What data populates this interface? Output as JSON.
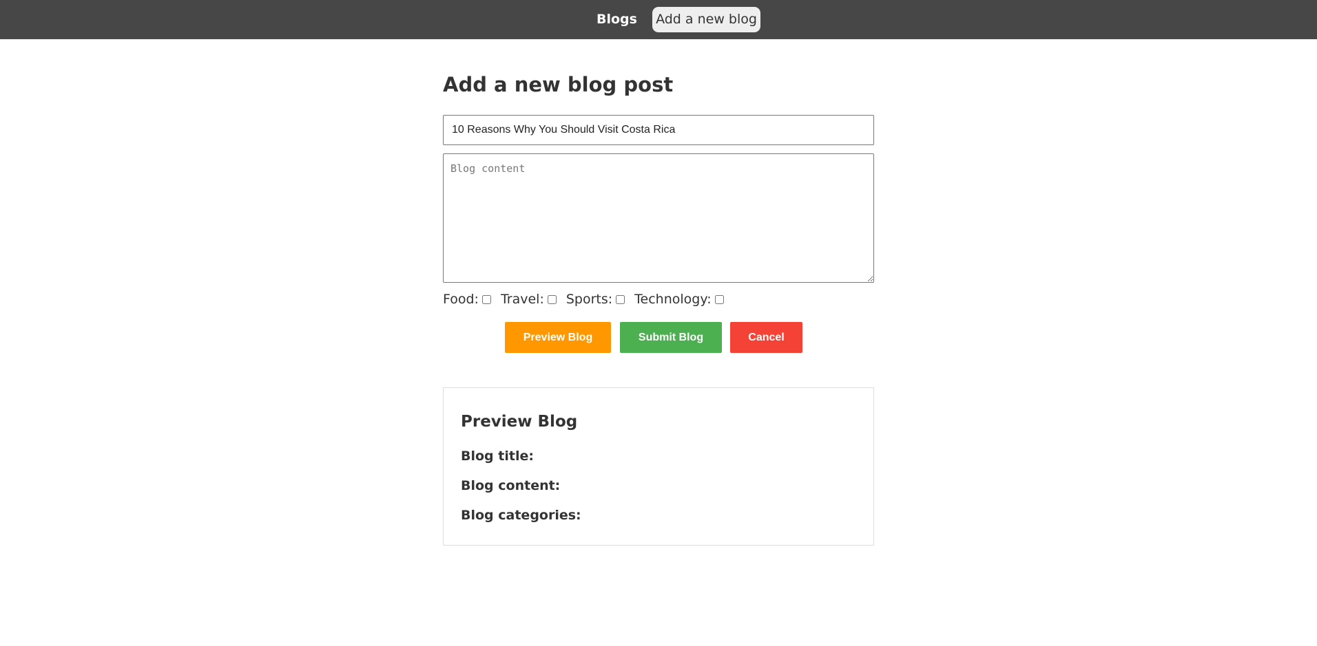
{
  "nav": {
    "blogs_label": "Blogs",
    "add_blog_label": "Add a new blog"
  },
  "form": {
    "heading": "Add a new blog post",
    "title_value": "10 Reasons Why You Should Visit Costa Rica",
    "content_value": "",
    "content_placeholder": "Blog content",
    "categories": [
      {
        "label": "Food:",
        "checked": false
      },
      {
        "label": "Travel:",
        "checked": false
      },
      {
        "label": "Sports:",
        "checked": false
      },
      {
        "label": "Technology:",
        "checked": false
      }
    ],
    "buttons": {
      "preview_label": "Preview Blog",
      "submit_label": "Submit Blog",
      "cancel_label": "Cancel"
    }
  },
  "preview": {
    "heading": "Preview Blog",
    "title_label": "Blog title:",
    "content_label": "Blog content:",
    "categories_label": "Blog categories:"
  },
  "colors": {
    "topbar": "#474747",
    "preview_button": "#ff9800",
    "submit_button": "#4caf50",
    "cancel_button": "#f44336"
  }
}
